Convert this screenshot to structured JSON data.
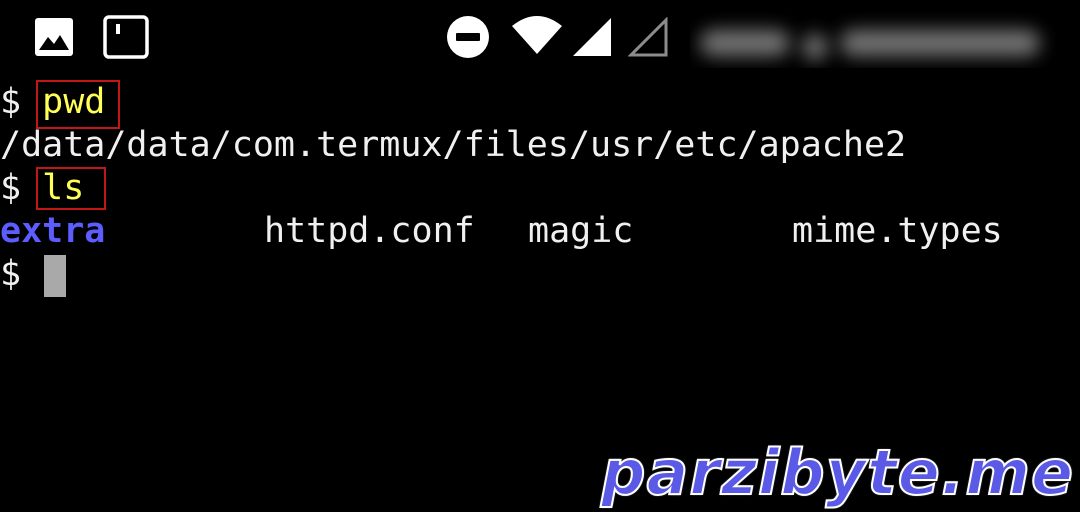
{
  "status_bar": {
    "icons": [
      "gallery-icon",
      "notification-icon",
      "do-not-disturb-icon",
      "wifi-icon",
      "signal-icon",
      "signal-empty-icon"
    ],
    "blurred_info": ""
  },
  "terminal": {
    "prompt": "$",
    "lines": [
      {
        "command": "pwd"
      },
      {
        "output": "/data/data/com.termux/files/usr/etc/apache2"
      },
      {
        "command": "ls"
      },
      {
        "entries": [
          {
            "name": "extra",
            "type": "directory"
          },
          {
            "name": "httpd.conf",
            "type": "file"
          },
          {
            "name": "magic",
            "type": "file"
          },
          {
            "name": "mime.types",
            "type": "file"
          }
        ]
      }
    ],
    "colors": {
      "foreground": "#f0f0f0",
      "command": "#ffff55",
      "directory": "#5c5cff",
      "highlight_box": "#c21717",
      "cursor": "#a9a9a9",
      "background": "#000000"
    }
  },
  "watermark": {
    "text": "parzibyte.me"
  }
}
